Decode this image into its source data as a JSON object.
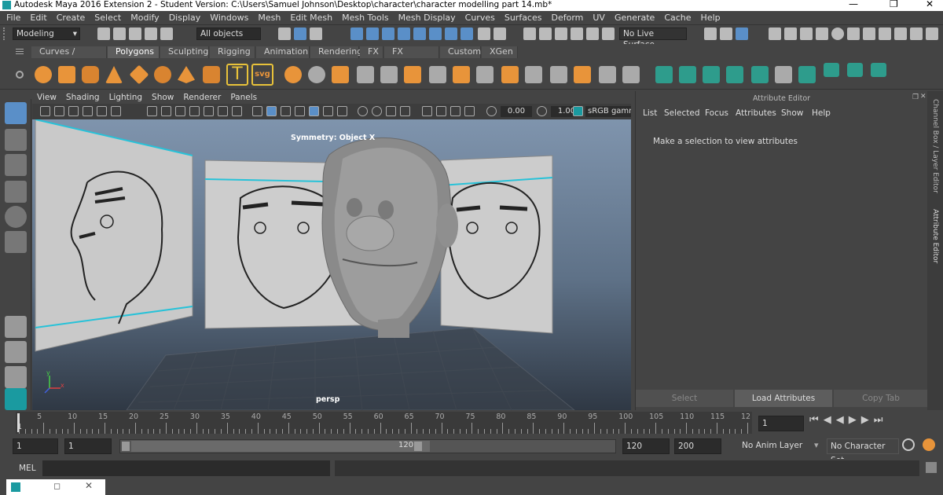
{
  "window": {
    "title": "Autodesk Maya 2016 Extension 2 - Student Version: C:\\Users\\Samuel Johnson\\Desktop\\character\\character modelling part 14.mb*"
  },
  "menus": [
    "File",
    "Edit",
    "Create",
    "Select",
    "Modify",
    "Display",
    "Windows",
    "Mesh",
    "Edit Mesh",
    "Mesh Tools",
    "Mesh Display",
    "Curves",
    "Surfaces",
    "Deform",
    "UV",
    "Generate",
    "Cache",
    "Help"
  ],
  "status": {
    "mode": "Modeling",
    "selection_mask": "All objects",
    "live_surface": "No Live Surface"
  },
  "shelf_tabs": [
    {
      "label": "Curves / Surfaces",
      "active": false
    },
    {
      "label": "Polygons",
      "active": true
    },
    {
      "label": "Sculpting",
      "active": false
    },
    {
      "label": "Rigging",
      "active": false
    },
    {
      "label": "Animation",
      "active": false
    },
    {
      "label": "Rendering",
      "active": false
    },
    {
      "label": "FX",
      "active": false
    },
    {
      "label": "FX Caching",
      "active": false
    },
    {
      "label": "Custom",
      "active": false
    },
    {
      "label": "XGen",
      "active": false
    }
  ],
  "shelf_text_icons": {
    "text_tool": "T",
    "svg_tool": "svg"
  },
  "viewport": {
    "menus": [
      "View",
      "Shading",
      "Lighting",
      "Show",
      "Renderer",
      "Panels"
    ],
    "field_a": "0.00",
    "field_b": "1.00",
    "colorspace": "sRGB gamm",
    "hud_symmetry": "Symmetry: Object X",
    "camera": "persp",
    "axis_x": "x",
    "axis_y": "y"
  },
  "attribute_editor": {
    "title": "Attribute Editor",
    "menus": [
      "List",
      "Selected",
      "Focus",
      "Attributes",
      "Show",
      "Help"
    ],
    "message": "Make a selection to view attributes",
    "buttons": {
      "select": "Select",
      "load": "Load Attributes",
      "copy": "Copy Tab"
    }
  },
  "side_tabs": {
    "channel_box": "Channel Box / Layer Editor",
    "attribute_editor": "Attribute Editor"
  },
  "timeline": {
    "ticks": [
      "5",
      "10",
      "15",
      "20",
      "25",
      "30",
      "35",
      "40",
      "45",
      "50",
      "55",
      "60",
      "65",
      "70",
      "75",
      "80",
      "85",
      "90",
      "95",
      "100",
      "105",
      "110",
      "115",
      "12"
    ],
    "start_label": "1",
    "current_frame": "1"
  },
  "range": {
    "start": "1",
    "playback_start": "1",
    "slider_start": "1",
    "slider_end": "120",
    "playback_end": "120",
    "end": "200",
    "anim_layer": "No Anim Layer",
    "character_set": "No Character Set"
  },
  "command_line": {
    "language": "MEL"
  }
}
